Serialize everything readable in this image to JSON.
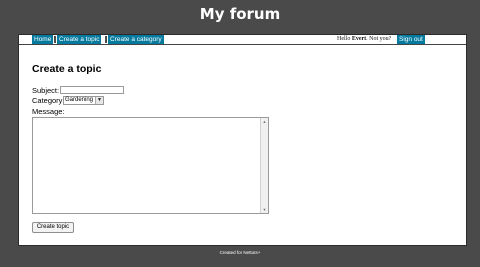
{
  "site": {
    "title": "My forum"
  },
  "menu": {
    "items": [
      {
        "label": "Home"
      },
      {
        "label": "Create a topic"
      },
      {
        "label": "Create a category"
      }
    ]
  },
  "userbar": {
    "greeting": "Hello ",
    "username": "Evert",
    "question": ". Not you?",
    "sign_out_label": "Sign out"
  },
  "form": {
    "heading": "Create a topic",
    "subject_label": "Subject:",
    "subject_value": "",
    "category_label": "Category:",
    "category_selected": "Gardening",
    "message_label": "Message:",
    "message_value": "",
    "submit_label": "Create topic"
  },
  "footer": {
    "text": "Created for Nettuts+"
  },
  "colors": {
    "background": "#4a4a4a",
    "menu_link_bg": "#057a9e",
    "content_bg": "#ffffff"
  }
}
